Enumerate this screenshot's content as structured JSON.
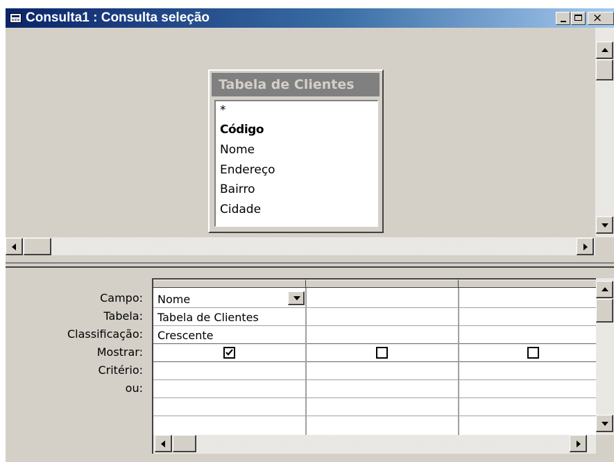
{
  "window": {
    "title": "Consulta1 : Consulta seleção",
    "title_icon": "query-icon",
    "minimize_icon": "minimize-icon",
    "maximize_icon": "maximize-icon",
    "close_icon": "close-icon",
    "close_glyph": "×"
  },
  "table_box": {
    "title": "Tabela de Clientes",
    "fields": [
      {
        "label": "*",
        "primary_key": false
      },
      {
        "label": "Código",
        "primary_key": true
      },
      {
        "label": "Nome",
        "primary_key": false
      },
      {
        "label": "Endereço",
        "primary_key": false
      },
      {
        "label": "Bairro",
        "primary_key": false
      },
      {
        "label": "Cidade",
        "primary_key": false
      }
    ]
  },
  "grid": {
    "row_labels": {
      "campo": "Campo:",
      "tabela": "Tabela:",
      "classificacao": "Classificação:",
      "mostrar": "Mostrar:",
      "criterio": "Critério:",
      "ou": "ou:"
    },
    "columns": [
      {
        "campo": "Nome",
        "tabela": "Tabela de Clientes",
        "classificacao": "Crescente",
        "mostrar": true,
        "criterio": "",
        "ou": ""
      },
      {
        "campo": "",
        "tabela": "",
        "classificacao": "",
        "mostrar": false,
        "criterio": "",
        "ou": ""
      },
      {
        "campo": "",
        "tabela": "",
        "classificacao": "",
        "mostrar": false,
        "criterio": "",
        "ou": ""
      }
    ]
  },
  "colors": {
    "title_gradient_start": "#0a246a",
    "title_gradient_end": "#a6caf0",
    "face": "#d4d0c8"
  }
}
